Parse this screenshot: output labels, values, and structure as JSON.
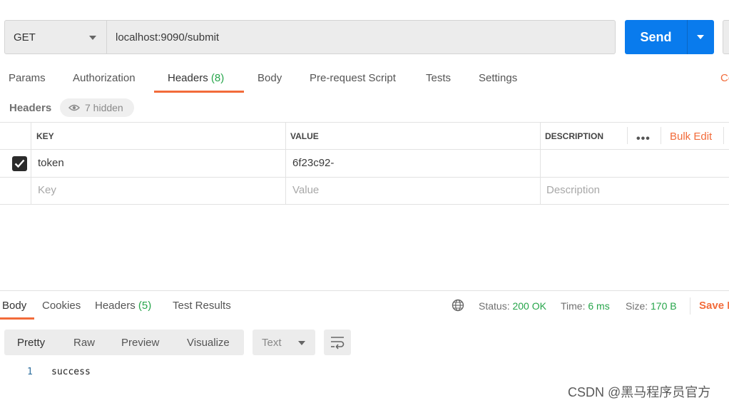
{
  "request": {
    "method": "GET",
    "url": "localhost:9090/submit",
    "send_label": "Send"
  },
  "request_tabs": [
    {
      "label": "Params"
    },
    {
      "label": "Authorization"
    },
    {
      "label": "Headers",
      "count": "(8)"
    },
    {
      "label": "Body"
    },
    {
      "label": "Pre-request Script"
    },
    {
      "label": "Tests"
    },
    {
      "label": "Settings"
    },
    {
      "label": "Co"
    }
  ],
  "headers_section": {
    "label": "Headers",
    "hidden_text": "7 hidden"
  },
  "table": {
    "columns": [
      "KEY",
      "VALUE",
      "DESCRIPTION"
    ],
    "bulk_edit": "Bulk Edit",
    "more": "•••",
    "rows": [
      {
        "checked": true,
        "key": "token",
        "value": "6f23c92-",
        "description": ""
      }
    ],
    "placeholders": {
      "key": "Key",
      "value": "Value",
      "description": "Description"
    }
  },
  "response_tabs": [
    {
      "label": "Body"
    },
    {
      "label": "Cookies"
    },
    {
      "label": "Headers",
      "count": "(5)"
    },
    {
      "label": "Test Results"
    }
  ],
  "response_meta": {
    "status_label": "Status:",
    "status_value": "200 OK",
    "time_label": "Time:",
    "time_value": "6 ms",
    "size_label": "Size:",
    "size_value": "170 B",
    "save_label": "Save R"
  },
  "format_tabs": [
    "Pretty",
    "Raw",
    "Preview",
    "Visualize"
  ],
  "language_select": "Text",
  "response_body": {
    "lines": [
      {
        "number": "1",
        "text": "success"
      }
    ]
  },
  "watermark": "CSDN @黑马程序员官方",
  "colors": {
    "accent": "#f26b3a",
    "send_blue": "#097bed",
    "success_green": "#26a54a"
  }
}
